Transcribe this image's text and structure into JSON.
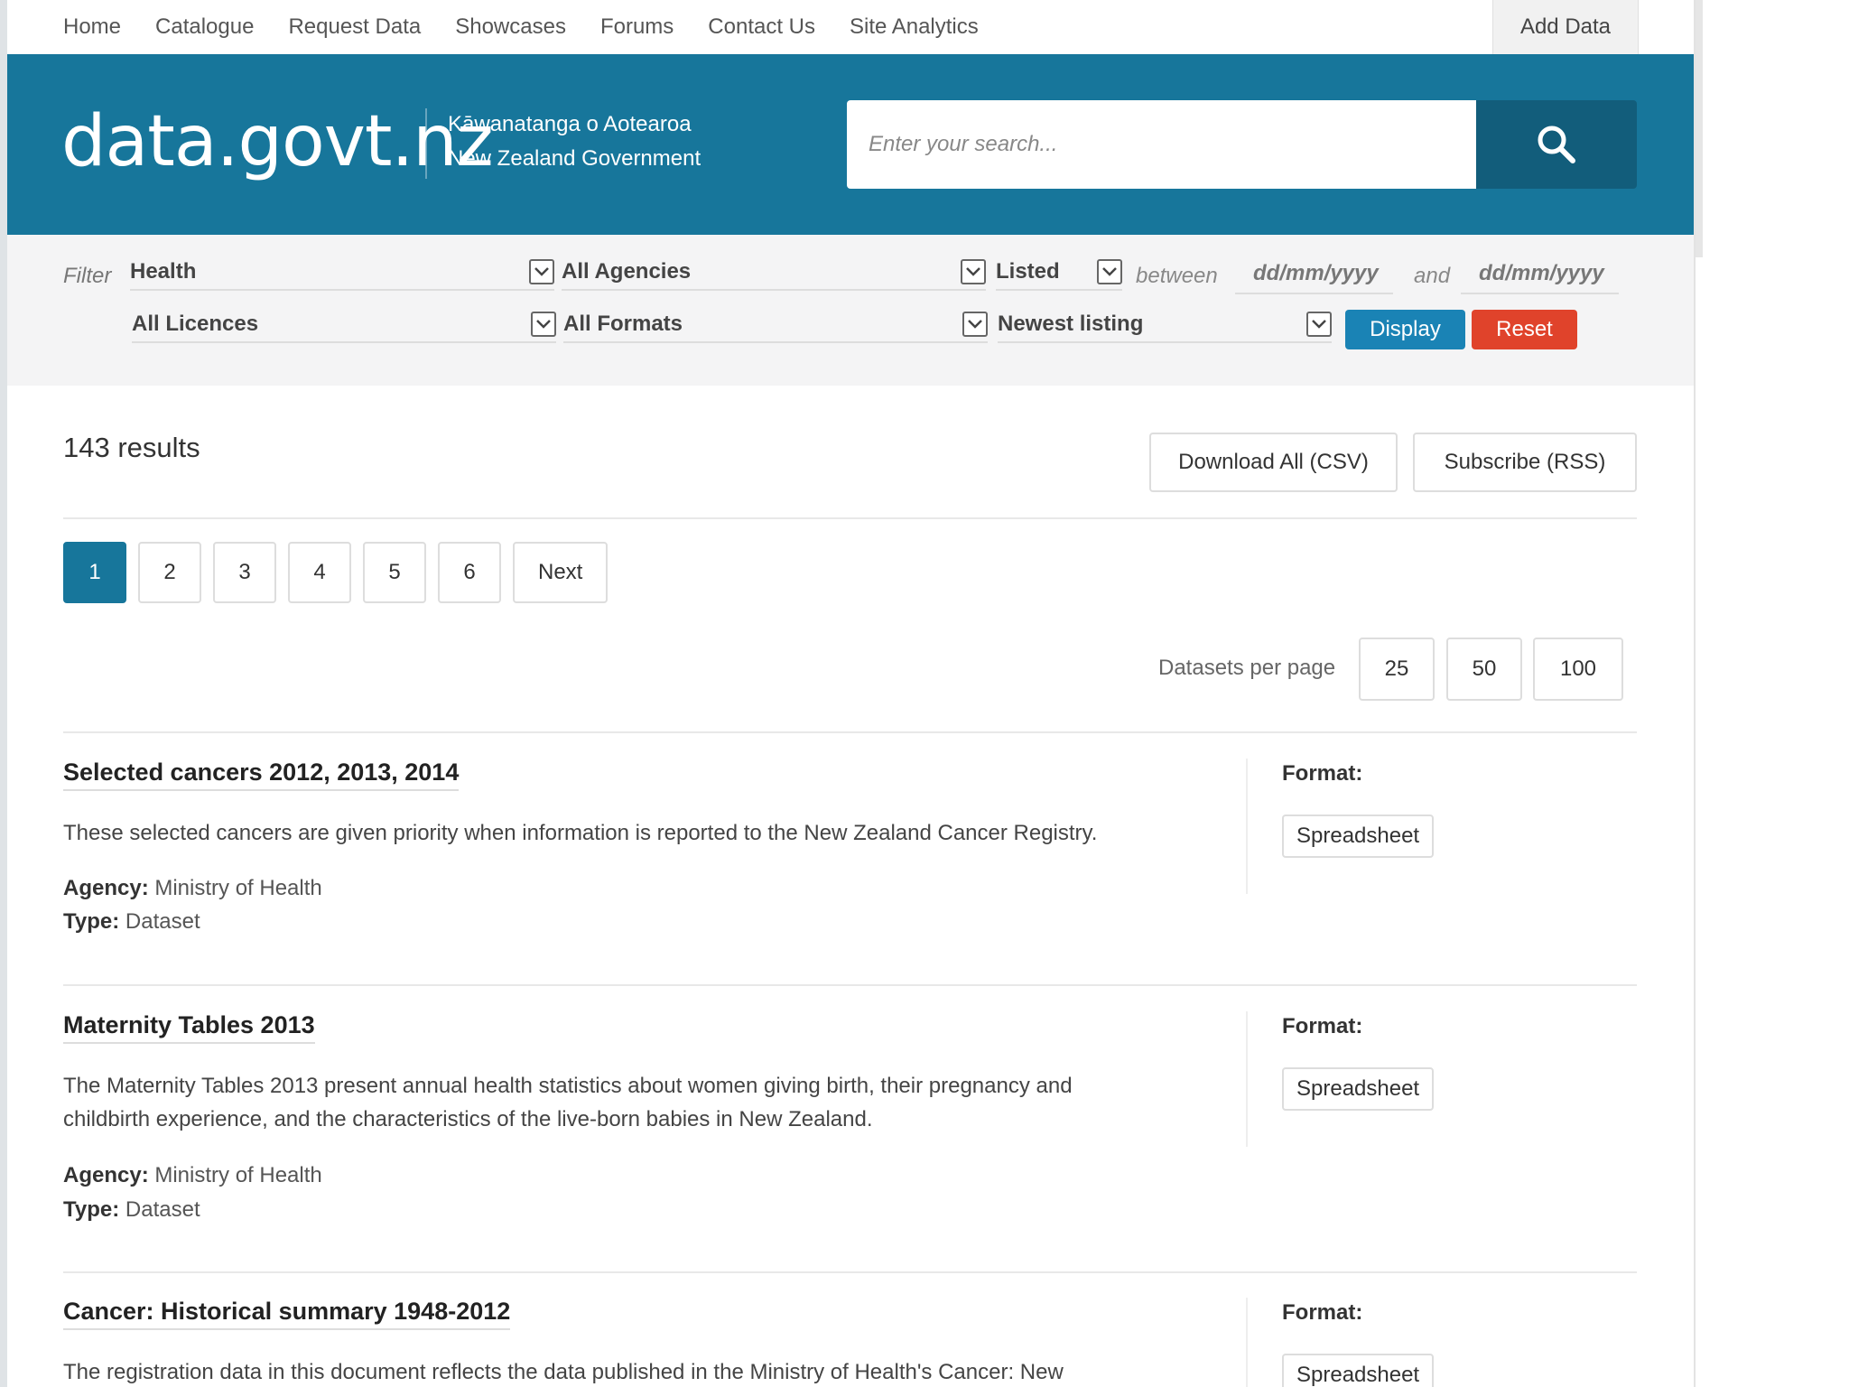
{
  "nav": {
    "links": [
      "Home",
      "Catalogue",
      "Request Data",
      "Showcases",
      "Forums",
      "Contact Us",
      "Site Analytics"
    ],
    "add_data": "Add Data"
  },
  "header": {
    "logo": "data.govt.nz",
    "gov_line1": "Kāwanatanga o Aotearoa",
    "gov_line2": "New Zealand Government",
    "search_placeholder": "Enter your search..."
  },
  "filter": {
    "label": "Filter",
    "category": "Health",
    "agency": "All Agencies",
    "listed": "Listed",
    "between": "between",
    "and": "and",
    "date_placeholder": "dd/mm/yyyy",
    "licence": "All Licences",
    "format": "All Formats",
    "sort": "Newest listing",
    "display_btn": "Display",
    "reset_btn": "Reset"
  },
  "results": {
    "count": "143 results",
    "download_btn": "Download All (CSV)",
    "subscribe_btn": "Subscribe (RSS)",
    "pages": [
      "1",
      "2",
      "3",
      "4",
      "5",
      "6"
    ],
    "next": "Next",
    "per_page_label": "Datasets per page",
    "per_page_options": [
      "25",
      "50",
      "100"
    ]
  },
  "datasets": [
    {
      "title": "Selected cancers 2012, 2013, 2014",
      "desc_lines": [
        "These selected cancers are given priority when information is reported to the New Zealand Cancer Registry."
      ],
      "agency_label": "Agency:",
      "agency": "Ministry of Health",
      "type_label": "Type:",
      "type": "Dataset",
      "format_label": "Format:",
      "format": "Spreadsheet"
    },
    {
      "title": "Maternity Tables 2013",
      "desc_lines": [
        "The Maternity Tables 2013 present annual health statistics about women giving birth, their pregnancy and",
        "childbirth experience, and the characteristics of the live-born babies in New Zealand."
      ],
      "agency_label": "Agency:",
      "agency": "Ministry of Health",
      "type_label": "Type:",
      "type": "Dataset",
      "format_label": "Format:",
      "format": "Spreadsheet"
    },
    {
      "title": "Cancer: Historical summary 1948-2012",
      "desc_lines": [
        "The registration data in this document reflects the data published in the Ministry of Health's Cancer: New"
      ],
      "format_label": "Format:",
      "format": "Spreadsheet"
    }
  ]
}
